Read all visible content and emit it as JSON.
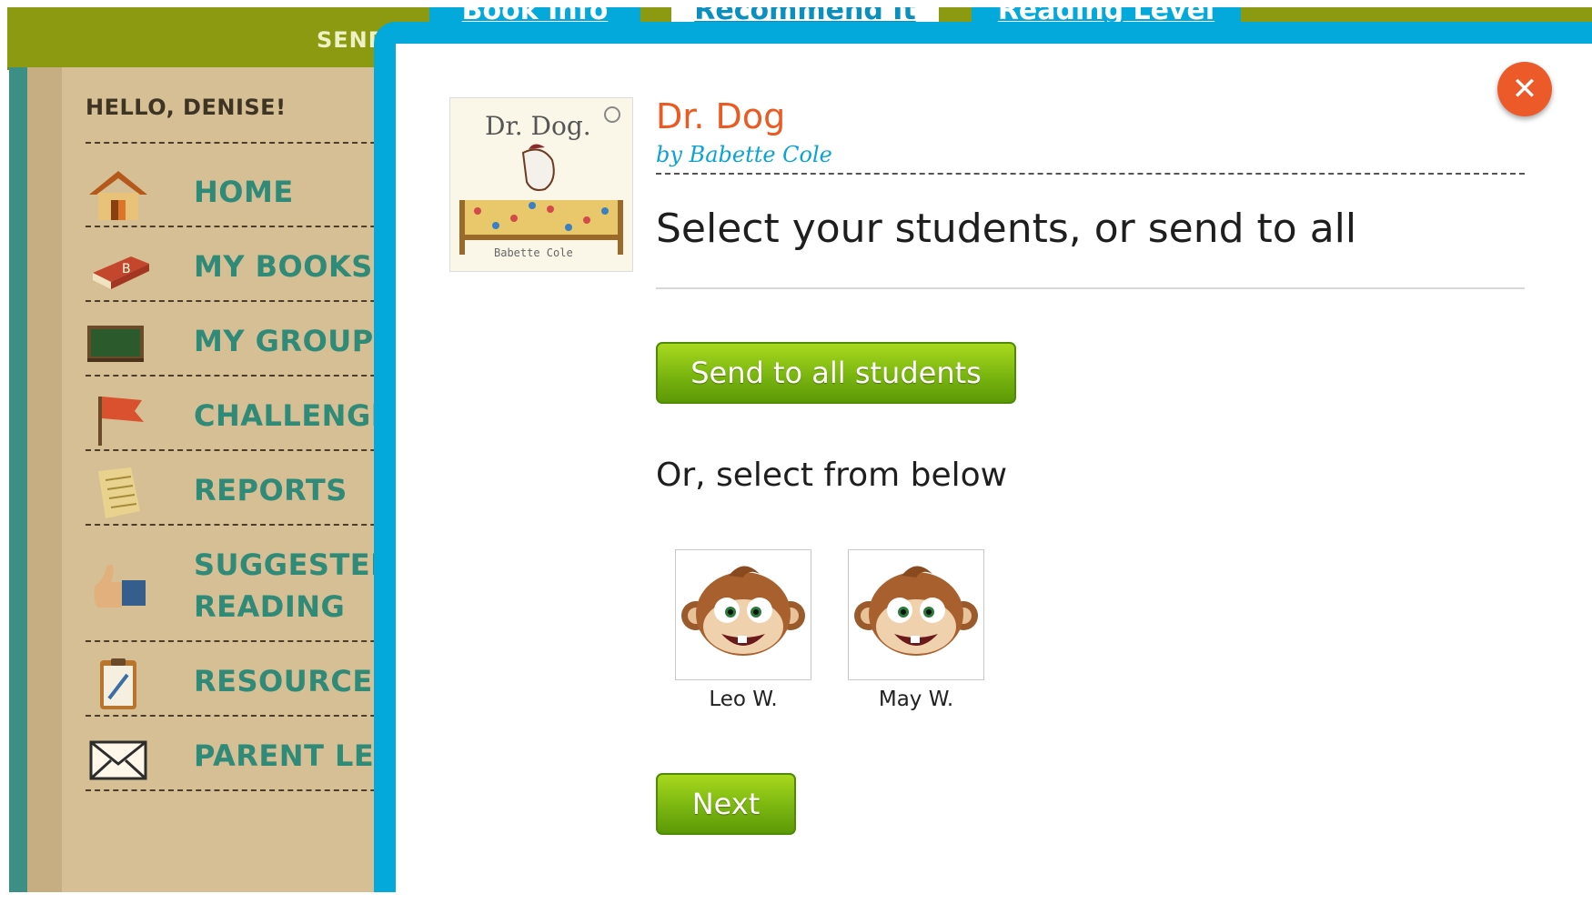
{
  "top_bar": {
    "text": "SEND"
  },
  "sidebar": {
    "greeting": "HELLO, DENISE!",
    "items": [
      {
        "label": "HOME",
        "icon": "house-icon"
      },
      {
        "label": "MY BOOKS",
        "icon": "book-icon"
      },
      {
        "label": "MY GROUPS",
        "icon": "chalkboard-icon"
      },
      {
        "label": "CHALLENGES",
        "icon": "flag-icon"
      },
      {
        "label": "REPORTS",
        "icon": "report-sheet-icon"
      },
      {
        "label": "SUGGESTED",
        "label2": "READING",
        "icon": "thumbs-up-icon"
      },
      {
        "label": "RESOURCES",
        "icon": "clipboard-icon"
      },
      {
        "label": "PARENT LETT",
        "icon": "envelope-icon"
      }
    ]
  },
  "modal": {
    "tabs": [
      {
        "label": "Book Info"
      },
      {
        "label": "Recommend It",
        "active": true
      },
      {
        "label": "Reading Level"
      }
    ],
    "close_icon": "close-icon",
    "book": {
      "title": "Dr. Dog",
      "author": "by Babette Cole",
      "cover_title": "Dr. Dog.",
      "cover_author": "Babette Cole"
    },
    "heading": "Select your students, or send to all",
    "send_all_label": "Send to all students",
    "subheading": "Or, select from below",
    "students": [
      {
        "name": "Leo W.",
        "avatar": "monkey-avatar-icon"
      },
      {
        "name": "May W.",
        "avatar": "monkey-avatar-icon"
      }
    ],
    "next_label": "Next"
  },
  "colors": {
    "modal_border": "#04a9db",
    "title": "#ea5a21",
    "author": "#0ba3d6",
    "button_green": "#7ab510",
    "close": "#ec5a2a",
    "sidebar_label": "#2f8a78",
    "top_bar": "#8c9a12"
  }
}
